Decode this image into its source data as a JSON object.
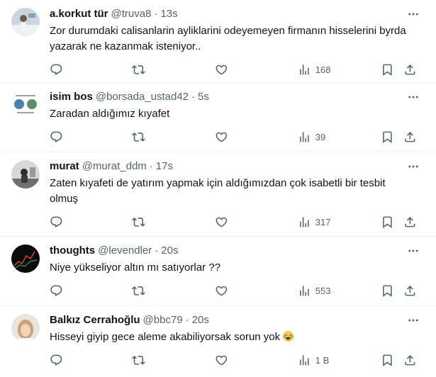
{
  "colors": {
    "text": "#0f1419",
    "secondary": "#536471",
    "border": "#eff3f4"
  },
  "tweets": [
    {
      "name": "a.korkut tür",
      "handle": "@truva8",
      "time": "13s",
      "text": "Zor durumdaki calisanlarin ayliklarini odeyemeyen firmanın hisselerini byrda yazarak ne kazanmak isteniyor..",
      "views": "168",
      "avatar": "avatar-person-snow"
    },
    {
      "name": "isim bos",
      "handle": "@borsada_ustad42",
      "time": "5s",
      "text": "Zaradan aldığımız kıyafet",
      "views": "39",
      "avatar": "avatar-globes-meme"
    },
    {
      "name": "murat",
      "handle": "@murat_ddm",
      "time": "17s",
      "text": "Zaten kıyafeti de yatırım yapmak için aldığımızdan çok isabetli bir tesbit olmuş",
      "views": "317",
      "avatar": "avatar-bw-photo"
    },
    {
      "name": "thoughts",
      "handle": "@levendler",
      "time": "20s",
      "text": "Niye yükseliyor altın mı satıyorlar ??",
      "views": "553",
      "avatar": "avatar-dark-chart"
    },
    {
      "name": "Balkız Cerrahoğlu",
      "handle": "@bbc79",
      "time": "20s",
      "text": "Hisseyi giyip gece aleme akabiliyorsak sorun yok",
      "views": "1 B",
      "avatar": "avatar-woman-portrait",
      "emoji": "face-with-tears-of-joy"
    }
  ]
}
